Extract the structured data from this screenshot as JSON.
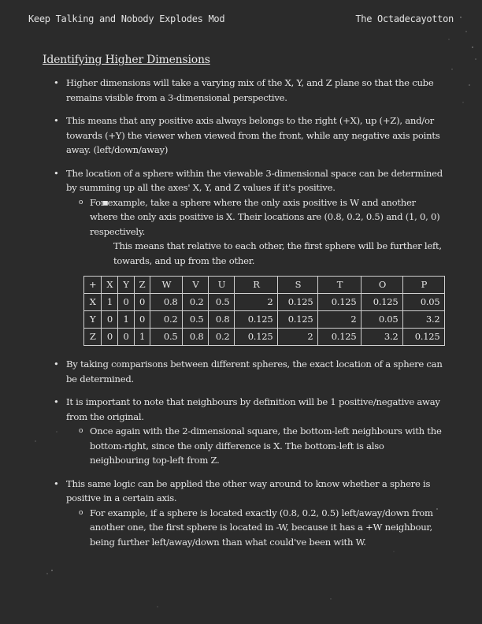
{
  "header": {
    "left": "Keep Talking and Nobody Explodes Mod",
    "right": "The Octadecayotton"
  },
  "title": "Identifying Higher Dimensions",
  "bullets": [
    {
      "text": "Higher dimensions will take a varying mix of the X, Y, and Z plane so that the cube remains visible from a 3-dimensional perspective."
    },
    {
      "text": "This means that any positive axis always belongs to the right (+X), up (+Z), and/or towards (+Y) the viewer when viewed from the front, while any negative axis points away. (left/down/away)"
    },
    {
      "text": "The location of a sphere within the viewable 3-dimensional space can be determined by summing up all the axes' X, Y, and Z values if it's positive.",
      "sub": "For example, take a sphere where the only axis positive is W and another where the only axis positive is X. Their locations are (0.8, 0.2, 0.5) and (1, 0, 0) respectively.",
      "subsub": "This means that relative to each other, the first sphere will be further left, towards, and up from the other."
    },
    {
      "text": "By taking comparisons between different spheres, the exact location of a sphere can be determined."
    },
    {
      "text": "It is important to note that neighbours by definition will be 1 positive/negative away from the original.",
      "sub": "Once again with the 2-dimensional square, the bottom-left neighbours with the bottom-right, since the only difference is X. The bottom-left is also neighbouring top-left from Z."
    },
    {
      "text": "This same logic can be applied the other way around to know whether a sphere is positive in a certain axis.",
      "sub": "For example, if a sphere is located exactly (0.8, 0.2, 0.5) left/away/down from another one, the first sphere is located in -W, because it has a +W neighbour, being further left/away/down than what could've been with W."
    }
  ],
  "table": {
    "headers": [
      "+",
      "X",
      "Y",
      "Z",
      "W",
      "V",
      "U",
      "R",
      "S",
      "T",
      "O",
      "P"
    ],
    "rows": [
      [
        "X",
        "1",
        "0",
        "0",
        "0.8",
        "0.2",
        "0.5",
        "2",
        "0.125",
        "0.125",
        "0.125",
        "0.05"
      ],
      [
        "Y",
        "0",
        "1",
        "0",
        "0.2",
        "0.5",
        "0.8",
        "0.125",
        "0.125",
        "2",
        "0.05",
        "3.2"
      ],
      [
        "Z",
        "0",
        "0",
        "1",
        "0.5",
        "0.8",
        "0.2",
        "0.125",
        "2",
        "0.125",
        "3.2",
        "0.125"
      ]
    ]
  },
  "bullet_glyphs": {
    "level1": "•",
    "level2": "o",
    "level3": "▪"
  }
}
